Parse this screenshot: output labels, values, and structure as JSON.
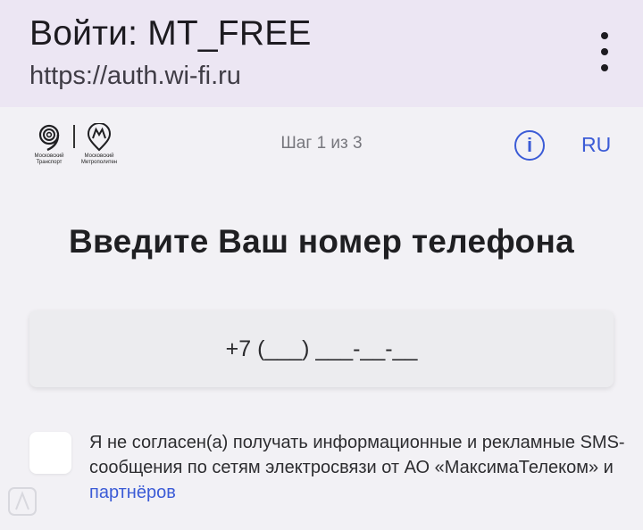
{
  "browser": {
    "title": "Войти: MT_FREE",
    "url": "https://auth.wi-fi.ru",
    "menu_icon": "more-vert-icon"
  },
  "header": {
    "logo_transport_caption": "Московский Транспорт",
    "logo_metro_caption": "Московский Метрополитен",
    "step_text": "Шаг 1 из 3",
    "info_icon": "info-icon",
    "language": "RU",
    "accent_color": "#3b5bd6"
  },
  "main": {
    "heading": "Введите Ваш номер телефона",
    "phone_placeholder": "+7 (___) ___-__-__"
  },
  "consent": {
    "text_before_link": "Я не согласен(а) получать информационные и рекламные SMS-сообщения по сетям электросвязи от АО «МаксимаТелеком» и ",
    "link_text": "партнёров"
  }
}
